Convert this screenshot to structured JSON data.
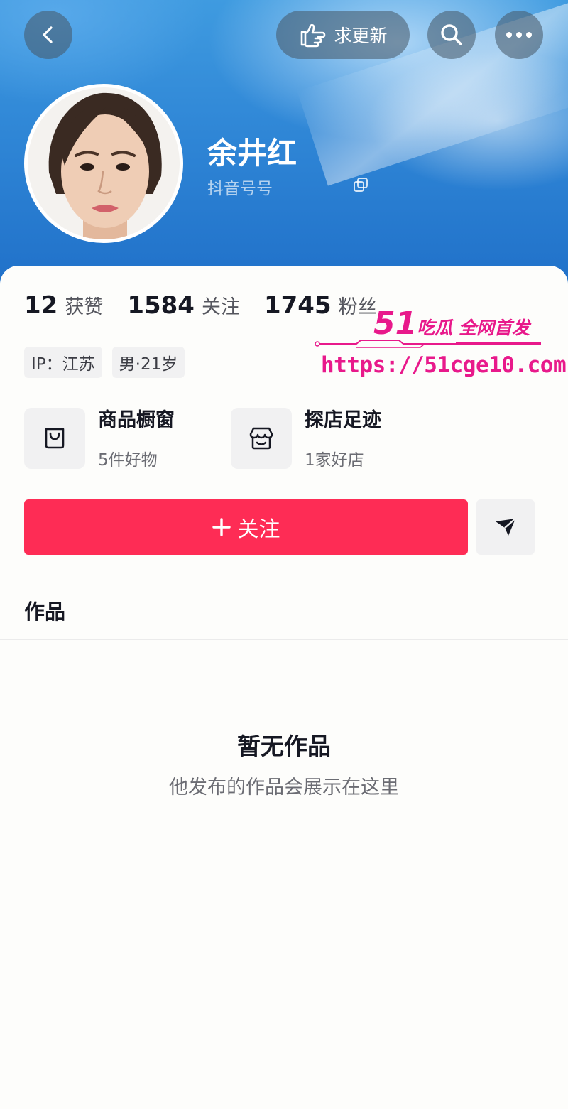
{
  "header": {
    "request_update_label": "求更新",
    "name": "余井红",
    "handle": "抖音号号",
    "colors": {
      "gradient_top": "#3f9be0",
      "gradient_bottom": "#1f6fc8"
    }
  },
  "stats": [
    {
      "value": "12",
      "label": "获赞"
    },
    {
      "value": "1584",
      "label": "关注"
    },
    {
      "value": "1745",
      "label": "粉丝"
    }
  ],
  "tags": {
    "ip": "IP：江苏",
    "gender_age": "男·21岁"
  },
  "features": {
    "showcase": {
      "title": "商品橱窗",
      "subtitle": "5件好物"
    },
    "shop_visits": {
      "title": "探店足迹",
      "subtitle": "1家好店"
    }
  },
  "actions": {
    "follow_label": "关注",
    "follow_color": "#fe2c55"
  },
  "tabs": {
    "works_label": "作品"
  },
  "empty_state": {
    "title": "暂无作品",
    "subtitle": "他发布的作品会展示在这里"
  },
  "watermark": {
    "brand_number": "51",
    "brand_text": "吃瓜 全网首发",
    "url": "https://51cge10.com",
    "color": "#e8198b"
  },
  "icons": [
    "back-icon",
    "request-update-hand-icon",
    "search-icon",
    "more-icon",
    "copy-icon",
    "shopping-bag-icon",
    "store-icon",
    "plus-icon",
    "send-icon"
  ]
}
